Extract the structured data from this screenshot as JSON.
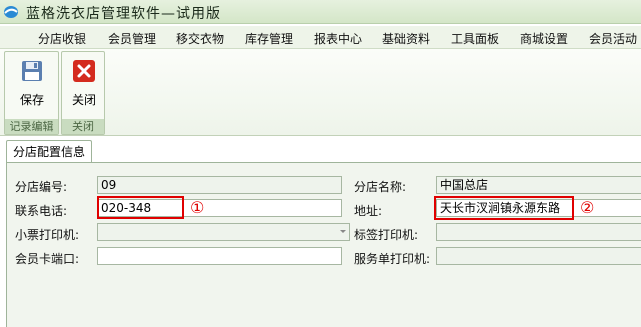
{
  "window": {
    "title": "蓝格洗衣店管理软件—试用版"
  },
  "menu": {
    "items": [
      "分店收银",
      "会员管理",
      "移交衣物",
      "库存管理",
      "报表中心",
      "基础资料",
      "工具面板",
      "商城设置",
      "会员活动"
    ]
  },
  "ribbon": {
    "save_label": "保存",
    "close_label": "关闭",
    "group1_caption": "记录编辑",
    "group2_caption": "关闭"
  },
  "tabs": {
    "active": "分店配置信息"
  },
  "form": {
    "branch_no_label": "分店编号:",
    "branch_no_value": "09",
    "branch_name_label": "分店名称:",
    "branch_name_value": "中国总店",
    "phone_label": "联系电话:",
    "phone_value": "020-348",
    "address_label": "地址:",
    "address_value": "天长市汊涧镇永源东路",
    "ticket_printer_label": "小票打印机:",
    "label_printer_label": "标签打印机:",
    "card_port_label": "会员卡端口:",
    "service_printer_label": "服务单打印机:"
  },
  "annotations": {
    "mark1": "①",
    "mark2": "②",
    "color": "#e00000"
  },
  "colors": {
    "accent": "#d4e6c8",
    "highlight": "#e00000"
  }
}
